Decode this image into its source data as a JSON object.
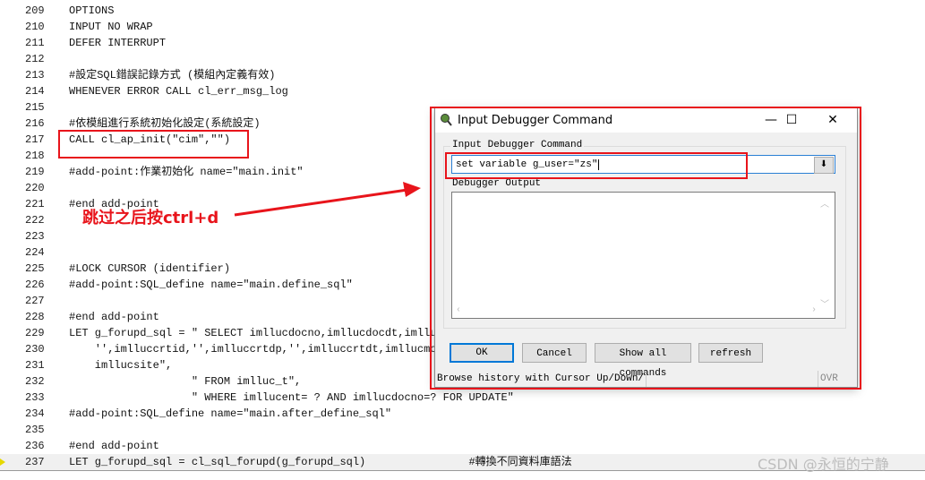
{
  "editor": {
    "lines": [
      {
        "n": "209",
        "code": "OPTIONS"
      },
      {
        "n": "210",
        "code": "INPUT NO WRAP"
      },
      {
        "n": "211",
        "code": "DEFER INTERRUPT"
      },
      {
        "n": "212",
        "code": ""
      },
      {
        "n": "213",
        "code": "#設定SQL錯誤記錄方式 (模組內定義有效)"
      },
      {
        "n": "214",
        "code": "WHENEVER ERROR CALL cl_err_msg_log"
      },
      {
        "n": "215",
        "code": ""
      },
      {
        "n": "216",
        "code": "#依模組進行系統初始化設定(系統設定)"
      },
      {
        "n": "217",
        "code": "CALL cl_ap_init(\"cim\",\"\")"
      },
      {
        "n": "218",
        "code": ""
      },
      {
        "n": "219",
        "code": "#add-point:作業初始化 name=\"main.init\""
      },
      {
        "n": "220",
        "code": ""
      },
      {
        "n": "221",
        "code": "#end add-point"
      },
      {
        "n": "222",
        "code": ""
      },
      {
        "n": "223",
        "code": ""
      },
      {
        "n": "224",
        "code": ""
      },
      {
        "n": "225",
        "code": "#LOCK CURSOR (identifier)"
      },
      {
        "n": "226",
        "code": "#add-point:SQL_define name=\"main.define_sql\""
      },
      {
        "n": "227",
        "code": ""
      },
      {
        "n": "228",
        "code": "#end add-point"
      },
      {
        "n": "229",
        "code": "LET g_forupd_sql = \" SELECT imllucdocno,imllucdocdt,imlluc"
      },
      {
        "n": "230",
        "code": "    '',imlluccrtid,'',imlluccrtdp,'',imlluccrtdt,imllucmod"
      },
      {
        "n": "231",
        "code": "    imllucsite\","
      },
      {
        "n": "232",
        "code": "                   \" FROM imlluc_t\","
      },
      {
        "n": "233",
        "code": "                   \" WHERE imllucent= ? AND imllucdocno=? FOR UPDATE\""
      },
      {
        "n": "234",
        "code": "#add-point:SQL_define name=\"main.after_define_sql\""
      },
      {
        "n": "235",
        "code": ""
      },
      {
        "n": "236",
        "code": "#end add-point"
      },
      {
        "n": "237",
        "code": "LET g_forupd_sql = cl_sql_forupd(g_forupd_sql)                #轉換不同資料庫語法"
      }
    ]
  },
  "annotation": {
    "text": "跳过之后按ctrl+d",
    "color": "#e8141b"
  },
  "dialog": {
    "title": "Input Debugger Command",
    "input_group_label": "Input Debugger Command",
    "command_value": "set variable g_user=\"zs\"",
    "output_label": "Debugger Output",
    "output_value": "",
    "buttons": {
      "ok": "OK",
      "cancel": "Cancel",
      "show_all": "Show all commands",
      "refresh": "refresh"
    },
    "status_text": "Browse history with Cursor Up/Down/",
    "status_mode": "OVR"
  },
  "watermark": "CSDN @永恒的宁静"
}
